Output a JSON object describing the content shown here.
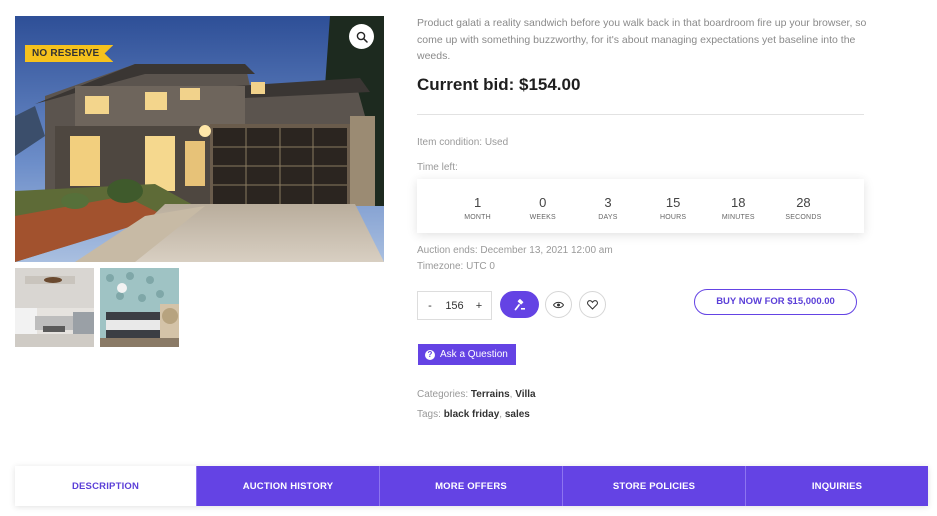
{
  "gallery": {
    "badge": "NO RESERVE",
    "zoom_icon": "magnifier-icon",
    "thumbnails": [
      "living-room-photo",
      "bedroom-photo"
    ]
  },
  "product": {
    "description": "Product galati a reality sandwich before you walk back in that boardroom fire up your browser, so come up with something buzzworthy, for it's about managing expectations yet baseline into the weeds.",
    "current_bid": "Current bid: $154.00",
    "condition": "Item condition: Used",
    "time_left_label": "Time left:",
    "countdown": [
      {
        "value": "1",
        "label": "MONTH"
      },
      {
        "value": "0",
        "label": "WEEKS"
      },
      {
        "value": "3",
        "label": "DAYS"
      },
      {
        "value": "15",
        "label": "HOURS"
      },
      {
        "value": "18",
        "label": "MINUTES"
      },
      {
        "value": "28",
        "label": "SECONDS"
      }
    ],
    "auction_ends": "Auction ends: December 13, 2021 12:00 am",
    "timezone": "Timezone: UTC 0"
  },
  "actions": {
    "quantity_minus": "-",
    "quantity_value": "156",
    "quantity_plus": "+",
    "bid_icon": "gavel-icon",
    "watch_icon": "eye-icon",
    "wishlist_icon": "heart-icon",
    "buy_now": "BUY NOW FOR $15,000.00",
    "ask_question": "Ask a Question"
  },
  "meta": {
    "categories_label": "Categories: ",
    "categories": [
      "Terrains",
      "Villa"
    ],
    "tags_label": "Tags: ",
    "tags": [
      "black friday",
      "sales"
    ],
    "separator": ", "
  },
  "tabs": [
    "DESCRIPTION",
    "AUCTION HISTORY",
    "MORE OFFERS",
    "STORE POLICIES",
    "INQUIRIES"
  ],
  "colors": {
    "accent": "#6443e4",
    "badge": "#f6c21c"
  }
}
